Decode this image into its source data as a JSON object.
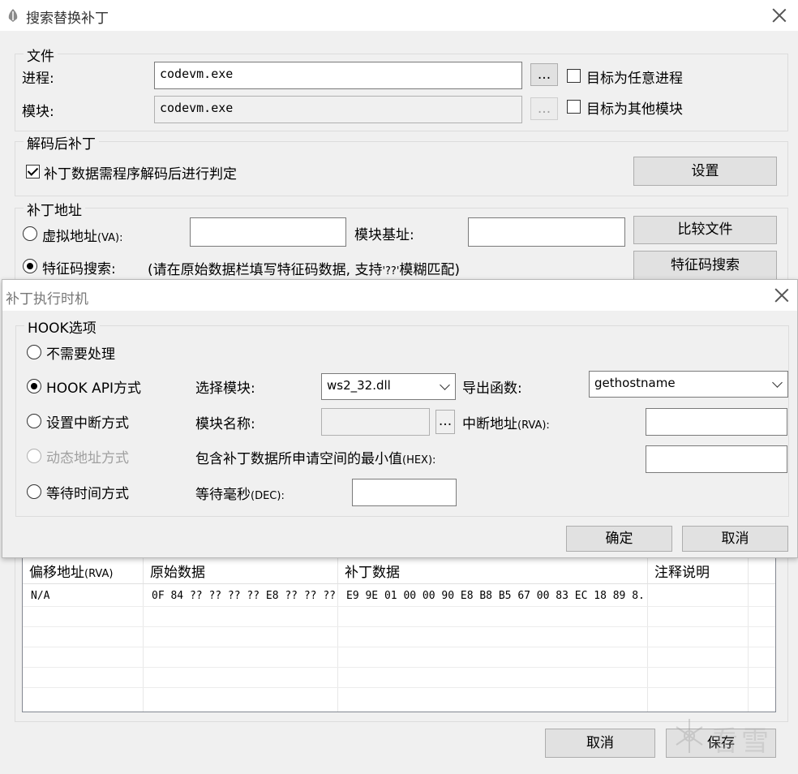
{
  "main_window": {
    "title": "搜索替换补丁",
    "file_group": {
      "legend": "文件",
      "process_label": "进程:",
      "process_value": "codevm.exe",
      "browse_label": "...",
      "target_any_process": "目标为任意进程",
      "module_label": "模块:",
      "module_value": "codevm.exe",
      "module_browse_label": "...",
      "target_other_module": "目标为其他模块"
    },
    "decode_group": {
      "legend": "解码后补丁",
      "checkbox_label": "补丁数据需程序解码后进行判定",
      "checked": true,
      "settings_button": "设置"
    },
    "address_group": {
      "legend": "补丁地址",
      "va_radio_label": "虚拟地址",
      "va_radio_suffix": "(VA):",
      "module_base_label": "模块基址:",
      "compare_button": "比较文件",
      "signature_radio_label": "特征码搜索:",
      "signature_hint_a": "(请在原始数据栏填写特征码数据, 支持",
      "signature_hint_b": "'??'",
      "signature_hint_c": "模糊匹配)",
      "signature_button": "特征码搜索",
      "selected": "signature"
    },
    "table": {
      "columns": [
        "偏移地址",
        "原始数据",
        "补丁数据",
        "注释说明"
      ],
      "column0_suffix": "(RVA)",
      "rows": [
        [
          "N/A",
          "0F 84 ?? ?? ?? ?? E8 ?? ?? ?? ...",
          "E9 9E 01 00 00 90 E8 B8 B5 67 00 83 EC 18 89 8...",
          ""
        ]
      ]
    },
    "cancel_button": "取消",
    "save_button": "保存",
    "watermark": "看雪"
  },
  "dialog": {
    "title": "补丁执行时机",
    "hook_group": {
      "legend": "HOOK选项",
      "no_process": "不需要处理",
      "hook_api": "HOOK API方式",
      "breakpoint": "设置中断方式",
      "dynamic_address": "动态地址方式",
      "wait_time": "等待时间方式",
      "selected": "hook_api",
      "select_module_label": "选择模块:",
      "select_module_value": "ws2_32.dll",
      "export_func_label": "导出函数:",
      "export_func_value": "gethostname",
      "module_name_label": "模块名称:",
      "module_name_browse": "...",
      "break_addr_label": "中断地址",
      "break_addr_suffix": "(RVA):",
      "min_space_label": "包含补丁数据所申请空间的最小值",
      "min_space_suffix": "(HEX):",
      "wait_ms_label": "等待毫秒",
      "wait_ms_suffix": "(DEC):"
    },
    "ok_button": "确定",
    "cancel_button": "取消"
  }
}
